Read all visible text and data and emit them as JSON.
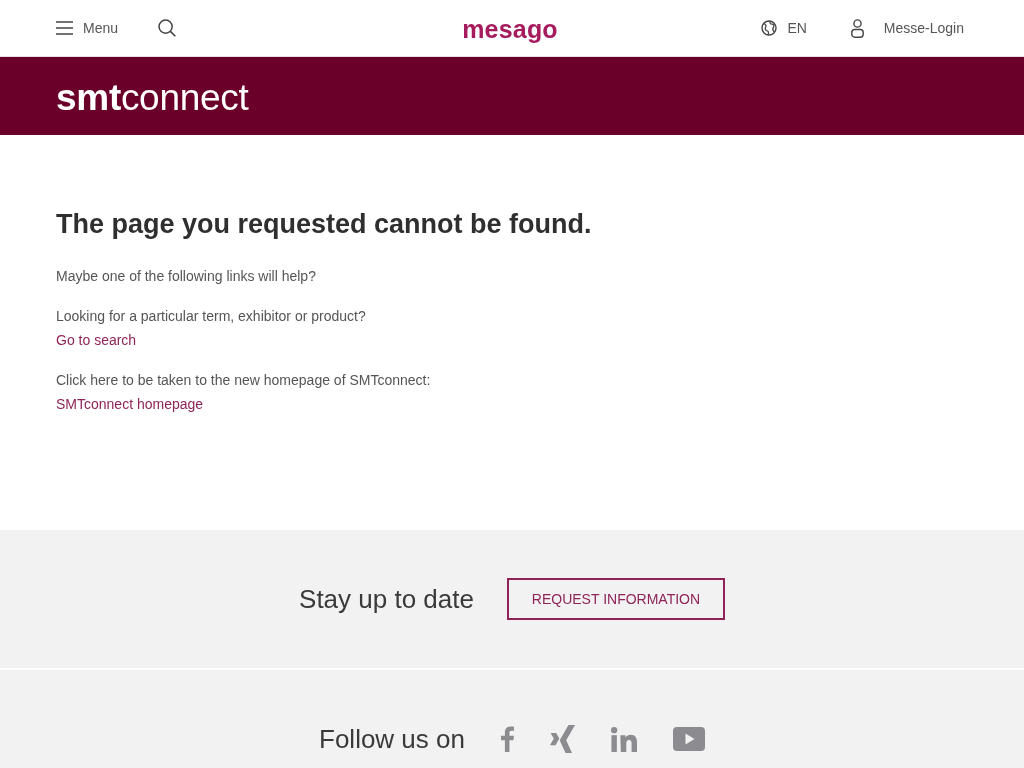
{
  "header": {
    "menu_label": "Menu",
    "brand": "mesago",
    "language": "EN",
    "login_label": "Messe-Login"
  },
  "banner": {
    "logo": "**smt**connect"
  },
  "content": {
    "heading": "The page you requested cannot be found.",
    "paragraphs": [
      {
        "text": "Maybe one of the following links will help?"
      },
      {
        "text": "Looking for a particular term, exhibitor or product?",
        "link": "Go to search"
      },
      {
        "text": "Click here to be taken to the new homepage of SMTconnect:",
        "link": "SMTconnect homepage"
      }
    ]
  },
  "newsletter": {
    "title": "Stay up to date",
    "button": "REQUEST INFORMATION"
  },
  "social": {
    "title": "Follow us on"
  }
}
